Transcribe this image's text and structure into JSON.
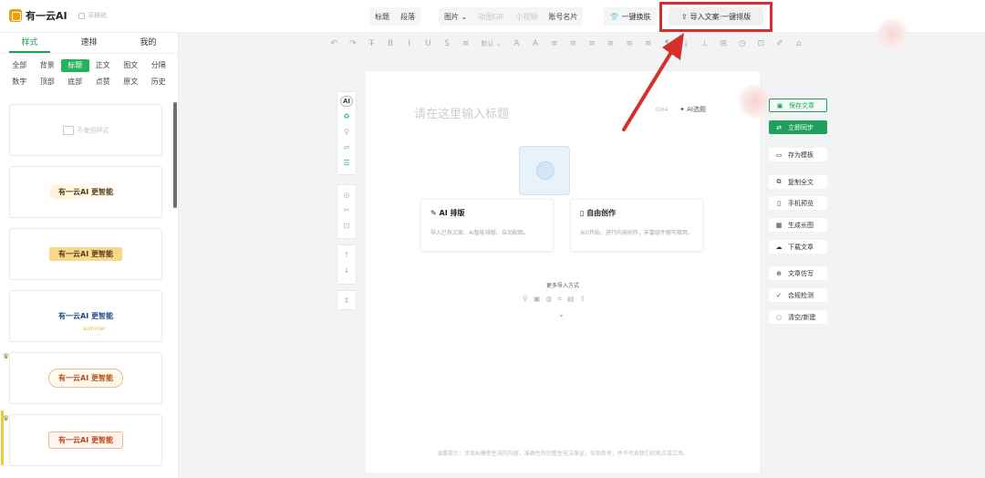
{
  "app": {
    "logo_text": "有一云AI",
    "draft_label": "草稿箱"
  },
  "top_nav": {
    "group1": [
      "标题",
      "段落"
    ],
    "group2": [
      "图片",
      "动图GIF",
      "小视频",
      "账号名片"
    ],
    "one_key_label": "一键换肤",
    "import_label": "导入文案·一键排版"
  },
  "left_panel": {
    "tabs": [
      "样式",
      "速排",
      "我的"
    ],
    "categories": [
      "全部",
      "背景",
      "标题",
      "正文",
      "图文",
      "分隔",
      "数字",
      "顶部",
      "底部",
      "点赞",
      "原文",
      "历史"
    ],
    "active_category": "标题",
    "cards": [
      {
        "label": "不使用样式"
      },
      {
        "label": "有一云AI 更智能"
      },
      {
        "label": "有一云AI 更智能"
      },
      {
        "label": "有一云AI 更智能",
        "sub": "summer"
      },
      {
        "label": "有一云AI 更智能"
      },
      {
        "label": "有一云AI 更智能"
      }
    ]
  },
  "toolbar": {
    "items": [
      "↶",
      "↷",
      "T̶",
      "B",
      "I",
      "U",
      "S",
      "≡",
      "默认",
      "A",
      "A",
      "≡",
      "≡",
      "≡",
      "≡",
      "≡",
      "≡",
      "¶",
      "⤓",
      "⟂",
      "⊞",
      "◷",
      "⊡",
      "✐",
      "⌂"
    ]
  },
  "side_tools": {
    "group1": [
      "AI",
      "♻",
      "♀",
      "⇌",
      "☰"
    ],
    "group2": [
      "◎",
      "✂",
      "⊡"
    ],
    "group3": [
      "↑",
      "↓"
    ],
    "group4": [
      "⇕"
    ]
  },
  "editor": {
    "title_placeholder": "请在这里输入标题",
    "count": "0/64",
    "ai_title_label": "AI选题",
    "card_ai_title": "AI 排版",
    "card_ai_desc": "导入已有文案，AI智能排版、自动配图。",
    "card_free_title": "自由创作",
    "card_free_desc": "从0开始，进行内容创作，丰富组件随写随用。",
    "more_import": "更多导入方式",
    "footer": "温馨提示：涉及AI模型生成的内容，准确性和完整性无法保证，仅供参考，并不代表我们的观点或立场。"
  },
  "right_panel": {
    "save": "保存文章",
    "sync": "立即同步",
    "template": "存为模板",
    "copy": "复制全文",
    "preview": "手机预览",
    "long_image": "生成长图",
    "download": "下载文章",
    "imitate": "文章仿写",
    "compliance": "合规检测",
    "clear": "清空/新建"
  },
  "colors": {
    "brand_green": "#1fa05a",
    "highlight_red": "#d62d2d"
  }
}
